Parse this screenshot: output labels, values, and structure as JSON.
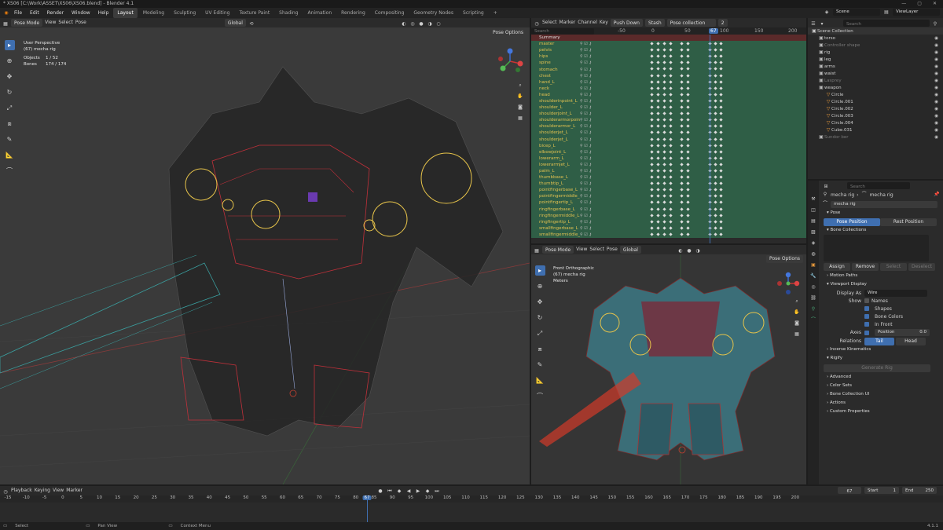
{
  "window_title": "* XS06 [C:\\Work\\ASSET\\XS06\\XS06.blend] - Blender 4.1",
  "menu": [
    "File",
    "Edit",
    "Render",
    "Window",
    "Help"
  ],
  "workspaces": [
    "Layout",
    "Modeling",
    "Sculpting",
    "UV Editing",
    "Texture Paint",
    "Shading",
    "Animation",
    "Rendering",
    "Compositing",
    "Geometry Nodes",
    "Scripting"
  ],
  "active_workspace": "Layout",
  "scene_label": "Scene",
  "viewlayer_label": "ViewLayer",
  "left_viewport": {
    "mode": "Pose Mode",
    "menus": [
      "View",
      "Select",
      "Pose"
    ],
    "orientation": "Global",
    "pose_options": "Pose Options",
    "info_lines": [
      "User Perspective",
      "(67) mecha rig"
    ],
    "objects_label": "Objects",
    "objects_value": "1 / 52",
    "bones_label": "Bones",
    "bones_value": "174 / 174"
  },
  "dopesheet": {
    "menus": [
      "Select",
      "Marker",
      "Channel",
      "Key"
    ],
    "push_down": "Push Down",
    "stash": "Stash",
    "collection": "Pose collection",
    "frame_count": "2",
    "search_placeholder": "Search",
    "summary": "Summary",
    "ruler": [
      "-50",
      "0",
      "50",
      "67",
      "100",
      "150",
      "200"
    ],
    "channels": [
      "master",
      "pelvis",
      "hips",
      "spine",
      "stomach",
      "chest",
      "hand_L",
      "neck",
      "head",
      "shoulderinpoint_L",
      "shoulder_L",
      "shoulderjoint_L",
      "shoulderarmorpoint_L",
      "shoulderarmor_L",
      "shoulderjet_L",
      "shoulderjet_L",
      "bicep_L",
      "elbowjoint_L",
      "lowerarm_L",
      "lowerarmjet_L",
      "palm_L",
      "thumbbase_L",
      "thumbtip_L",
      "pointfingerbase_L",
      "pointfingermiddle_L",
      "pointfingertip_L",
      "ringfingerbase_L",
      "ringfingermiddle_L",
      "ringfingertip_L",
      "smallfingerbase_L",
      "smallfingermiddle_L"
    ]
  },
  "right_viewport": {
    "mode": "Pose Mode",
    "menus": [
      "View",
      "Select",
      "Pose"
    ],
    "orientation": "Global",
    "pose_options": "Pose Options",
    "info_lines": [
      "Front Orthographic",
      "(67) mecha rig",
      "Meters"
    ]
  },
  "outliner": {
    "search_placeholder": "Search",
    "root": "Scene Collection",
    "items": [
      {
        "name": "torso",
        "indent": 1
      },
      {
        "name": "Controller shape",
        "indent": 1,
        "dim": true
      },
      {
        "name": "rig",
        "indent": 1
      },
      {
        "name": "leg",
        "indent": 1
      },
      {
        "name": "arms",
        "indent": 1
      },
      {
        "name": "waist",
        "indent": 1
      },
      {
        "name": "Lasprey",
        "indent": 1,
        "dim": true
      },
      {
        "name": "weapon",
        "indent": 1
      },
      {
        "name": "Circle",
        "indent": 2
      },
      {
        "name": "Circle.001",
        "indent": 2
      },
      {
        "name": "Circle.002",
        "indent": 2
      },
      {
        "name": "Circle.003",
        "indent": 2
      },
      {
        "name": "Circle.004",
        "indent": 2
      },
      {
        "name": "Cube.031",
        "indent": 2
      },
      {
        "name": "Sundor ber",
        "indent": 1,
        "dim": true
      }
    ]
  },
  "properties": {
    "search_placeholder": "Search",
    "breadcrumb_a": "mecha rig",
    "breadcrumb_b": "mecha rig",
    "object_name": "mecha rig",
    "pose_section": "Pose",
    "pose_position": "Pose Position",
    "rest_position": "Rest Position",
    "bone_collections": "Bone Collections",
    "assign": "Assign",
    "remove": "Remove",
    "select": "Select",
    "deselect": "Deselect",
    "motion_paths": "Motion Paths",
    "viewport_display": "Viewport Display",
    "display_as_label": "Display As",
    "display_as_value": "Wire",
    "show_label": "Show",
    "show_names": "Names",
    "show_shapes": "Shapes",
    "show_bone_colors": "Bone Colors",
    "show_in_front": "In Front",
    "axes_label": "Axes",
    "axes_position": "Position",
    "axes_position_value": "0.0",
    "relations_label": "Relations",
    "relations_tail": "Tail",
    "relations_head": "Head",
    "inverse_kinematics": "Inverse Kinematics",
    "rigify": "Rigify",
    "generate_rig": "Generate Rig",
    "advanced": "Advanced",
    "color_sets": "Color Sets",
    "bone_collection_ui": "Bone Collection UI",
    "actions": "Actions",
    "custom_properties": "Custom Properties"
  },
  "timeline": {
    "menus": [
      "Playback",
      "Keying",
      "View",
      "Marker"
    ],
    "current_frame": "67",
    "start_label": "Start",
    "start_value": "1",
    "end_label": "End",
    "end_value": "250",
    "ruler": [
      "-15",
      "-10",
      "-5",
      "0",
      "5",
      "10",
      "15",
      "20",
      "25",
      "30",
      "35",
      "40",
      "45",
      "50",
      "55",
      "60",
      "65",
      "67",
      "70",
      "75",
      "80",
      "85",
      "90",
      "95",
      "100",
      "105",
      "110",
      "115",
      "120",
      "125",
      "130",
      "135",
      "140",
      "145",
      "150",
      "155",
      "160",
      "165",
      "170",
      "175",
      "180",
      "185",
      "190",
      "195",
      "200"
    ]
  },
  "status_bar": {
    "select": "Select",
    "pan_view": "Pan View",
    "context_menu": "Context Menu",
    "version": "4.1.1"
  },
  "colors": {
    "accent": "#3f6fb0",
    "key_green": "#2f5e46",
    "bone_yellow": "#e6c34a",
    "bone_red": "#c0303a"
  }
}
